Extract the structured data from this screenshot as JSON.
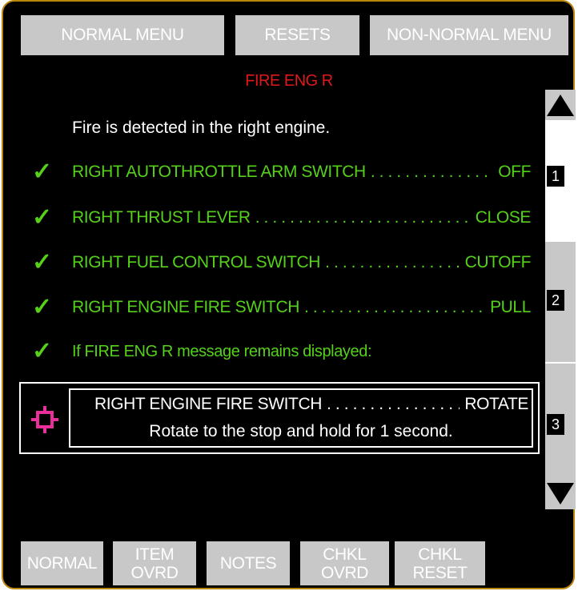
{
  "tabs": {
    "normal_menu": "NORMAL MENU",
    "resets": "RESETS",
    "non_normal_menu": "NON-NORMAL MENU"
  },
  "checklist": {
    "title": "FIRE ENG R",
    "intro": "Fire is detected in the right engine.",
    "items": [
      {
        "label": "RIGHT AUTOTHROTTLE ARM SWITCH",
        "action": "OFF",
        "checked": true
      },
      {
        "label": "RIGHT THRUST LEVER",
        "action": "CLOSE",
        "checked": true
      },
      {
        "label": "RIGHT FUEL CONTROL SWITCH",
        "action": "CUTOFF",
        "checked": true
      },
      {
        "label": "RIGHT ENGINE FIRE SWITCH",
        "action": "PULL",
        "checked": true
      }
    ],
    "condition": {
      "text": "If FIRE ENG R message remains displayed:",
      "checked": true
    },
    "current_step": {
      "label": "RIGHT ENGINE FIRE SWITCH",
      "action": "ROTATE",
      "instruction": "Rotate to the stop and hold for 1 second."
    }
  },
  "scrollbar": {
    "pages": [
      "1",
      "2",
      "3"
    ],
    "current_page": "1"
  },
  "bottom_buttons": {
    "normal": "NORMAL",
    "item_ovrd": [
      "ITEM",
      "OVRD"
    ],
    "notes": "NOTES",
    "chkl_ovrd": [
      "CHKL",
      "OVRD"
    ],
    "chkl_reset": [
      "CHKL",
      "RESET"
    ]
  },
  "colors": {
    "background": "#000000",
    "button": "#c8c8c8",
    "title": "#e01818",
    "checked_item": "#55d11a",
    "target_icon": "#e8309a",
    "bezel": "#b8860b"
  },
  "icons": {
    "check": "check-icon",
    "current_item": "crosshair-target-icon",
    "scroll_up": "arrow-up-icon",
    "scroll_down": "arrow-down-icon"
  }
}
